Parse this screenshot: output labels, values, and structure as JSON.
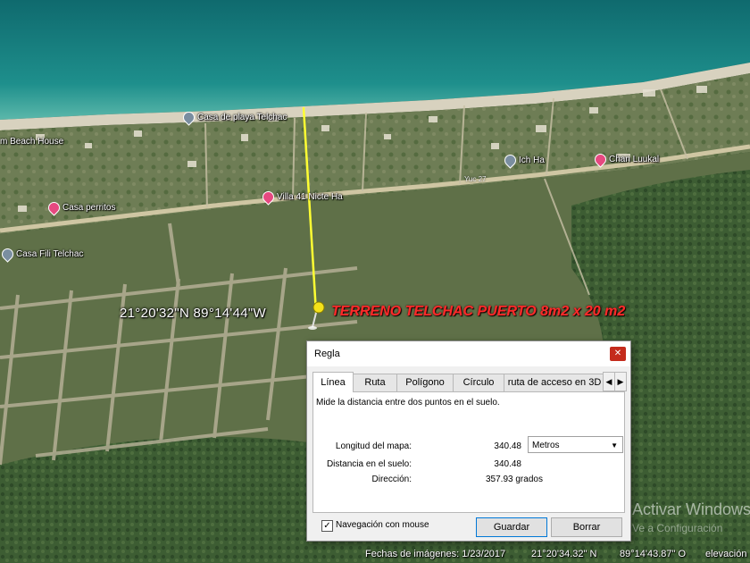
{
  "map": {
    "places": [
      {
        "name": "Casa de playa Telchac",
        "pin": "gray"
      },
      {
        "name": "Ich Ha",
        "pin": "gray"
      },
      {
        "name": "Chan Luukal",
        "pin": "pink"
      },
      {
        "name": "Casa perritos",
        "pin": "pink"
      },
      {
        "name": "Villa 41 Nicte Ha",
        "pin": "pink"
      },
      {
        "name": "Casa Fili Telchac",
        "pin": "gray"
      },
      {
        "name": "m Beach House",
        "pin": "none"
      }
    ],
    "road_label": "Yuc 27",
    "coordinate_overlay": "21°20'32\"N 89°14'44\"W",
    "terreno_label": "TERRENO TELCHAC PUERTO 8m2 x 20 m2",
    "icons": {
      "placemark": "pushpin-icon"
    }
  },
  "dialog": {
    "title": "Regla",
    "close_icon": "close-icon",
    "tabs": [
      {
        "label": "Línea",
        "active": true
      },
      {
        "label": "Ruta",
        "active": false
      },
      {
        "label": "Polígono",
        "active": false
      },
      {
        "label": "Círculo",
        "active": false
      },
      {
        "label": "ruta de acceso en 3D",
        "active": false
      }
    ],
    "description": "Mide la distancia entre dos puntos en el suelo.",
    "fields": {
      "map_length_label": "Longitud del mapa:",
      "map_length_value": "340.48",
      "unit_selected": "Metros",
      "ground_distance_label": "Distancia en el suelo:",
      "ground_distance_value": "340.48",
      "direction_label": "Dirección:",
      "direction_value": "357.93 grados"
    },
    "mouse_nav": {
      "label": "Navegación con mouse",
      "checked": true
    },
    "save_button": "Guardar",
    "clear_button": "Borrar"
  },
  "statusbar": {
    "imagery_date": "Fechas de imágenes: 1/23/2017",
    "lat": "21°20'34.32\" N",
    "lon": "89°14'43.87\" O",
    "elevation": "elevación"
  },
  "watermark": {
    "title": "Activar Windows",
    "subtitle": "Ve a Configuración"
  },
  "colors": {
    "sea": "#1a8a8a",
    "beach": "#d9d2c0",
    "vegetation": "#4a6a3a",
    "measure_line": "#ffff33",
    "terreno_text": "#ff2a2a"
  }
}
